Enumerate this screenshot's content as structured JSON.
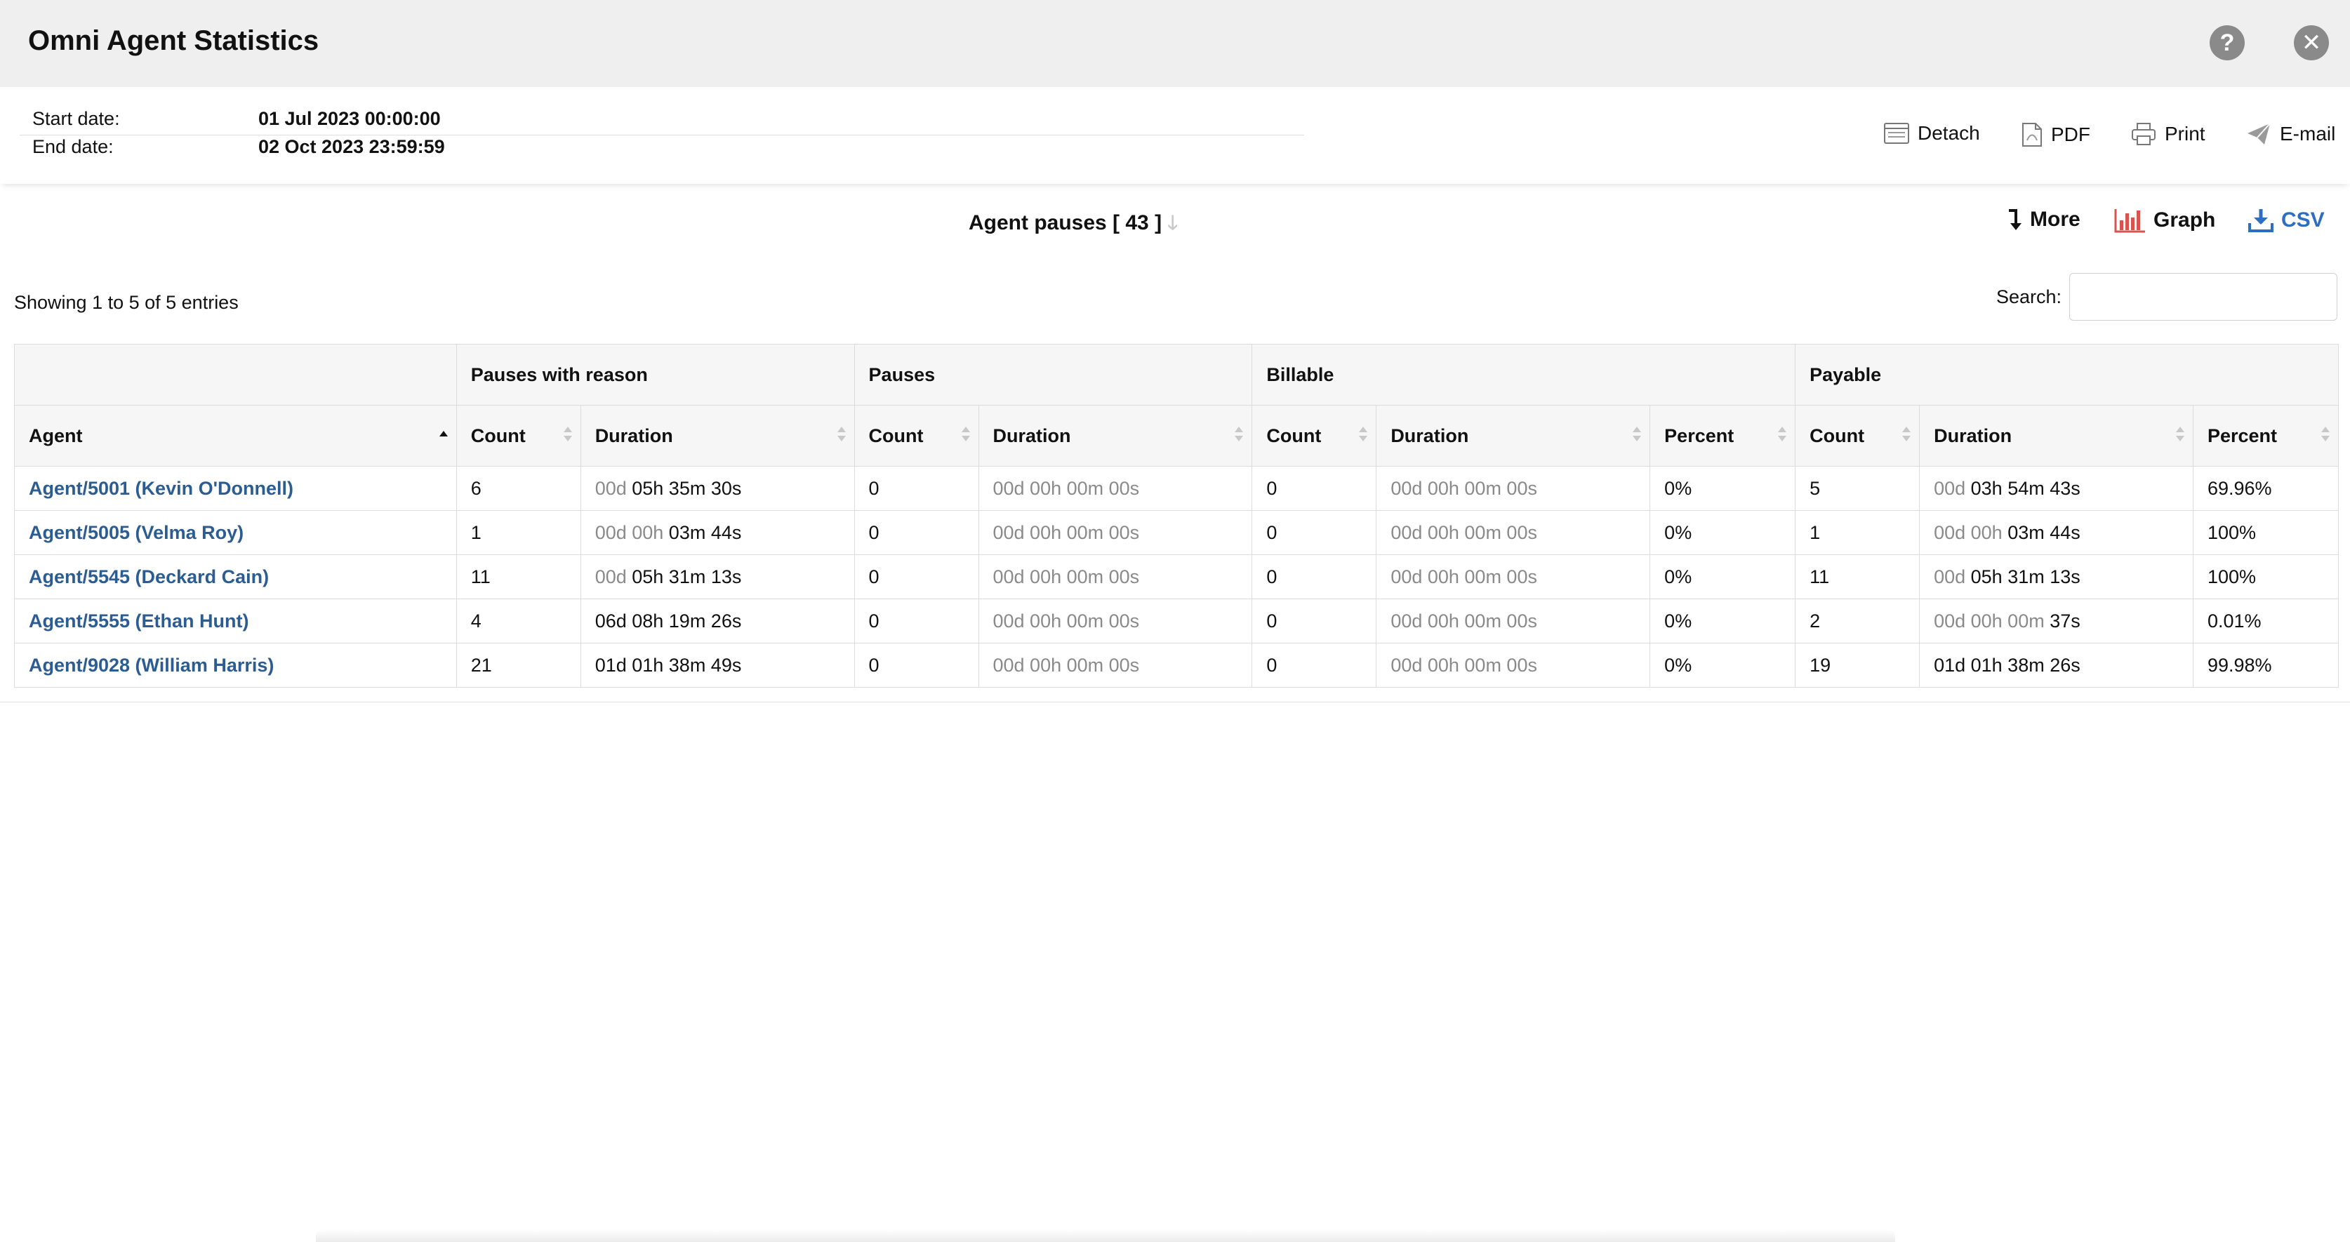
{
  "window": {
    "title": "Omni Agent Statistics"
  },
  "dates": {
    "start_label": "Start date:",
    "start_value": "01 Jul 2023 00:00:00",
    "end_label": "End date:",
    "end_value": "02 Oct 2023 23:59:59"
  },
  "actions": {
    "detach": "Detach",
    "pdf": "PDF",
    "print": "Print",
    "email": "E-mail"
  },
  "section": {
    "title": "Agent pauses [ 43 ]"
  },
  "tools": {
    "more": "More",
    "graph": "Graph",
    "csv": "CSV"
  },
  "table_info": {
    "showing": "Showing 1 to 5 of 5 entries",
    "search_label": "Search:",
    "search_value": ""
  },
  "colors": {
    "link": "#2c5d92",
    "graph_icon": "#d9534f",
    "csv": "#2d6ec0"
  },
  "table": {
    "groups": [
      "",
      "Pauses with reason",
      "Pauses",
      "Billable",
      "Payable"
    ],
    "columns": [
      "Agent",
      "Count",
      "Duration",
      "Count",
      "Duration",
      "Count",
      "Duration",
      "Percent",
      "Count",
      "Duration",
      "Percent"
    ],
    "rows": [
      [
        "Agent/5001 (Kevin O'Donnell)",
        "6",
        [
          "00d ",
          "05h 35m 30s"
        ],
        "0",
        [
          "00d 00h 00m 00s",
          ""
        ],
        "0",
        [
          "00d 00h 00m 00s",
          ""
        ],
        "0%",
        "5",
        [
          "00d ",
          "03h 54m 43s"
        ],
        "69.96%"
      ],
      [
        "Agent/5005 (Velma Roy)",
        "1",
        [
          "00d 00h ",
          "03m 44s"
        ],
        "0",
        [
          "00d 00h 00m 00s",
          ""
        ],
        "0",
        [
          "00d 00h 00m 00s",
          ""
        ],
        "0%",
        "1",
        [
          "00d 00h ",
          "03m 44s"
        ],
        "100%"
      ],
      [
        "Agent/5545 (Deckard Cain)",
        "11",
        [
          "00d ",
          "05h 31m 13s"
        ],
        "0",
        [
          "00d 00h 00m 00s",
          ""
        ],
        "0",
        [
          "00d 00h 00m 00s",
          ""
        ],
        "0%",
        "11",
        [
          "00d ",
          "05h 31m 13s"
        ],
        "100%"
      ],
      [
        "Agent/5555 (Ethan Hunt)",
        "4",
        [
          "",
          "06d 08h 19m 26s"
        ],
        "0",
        [
          "00d 00h 00m 00s",
          ""
        ],
        "0",
        [
          "00d 00h 00m 00s",
          ""
        ],
        "0%",
        "2",
        [
          "00d 00h 00m ",
          "37s"
        ],
        "0.01%"
      ],
      [
        "Agent/9028 (William Harris)",
        "21",
        [
          "",
          "01d 01h 38m 49s"
        ],
        "0",
        [
          "00d 00h 00m 00s",
          ""
        ],
        "0",
        [
          "00d 00h 00m 00s",
          ""
        ],
        "0%",
        "19",
        [
          "",
          "01d 01h 38m 26s"
        ],
        "99.98%"
      ]
    ]
  }
}
